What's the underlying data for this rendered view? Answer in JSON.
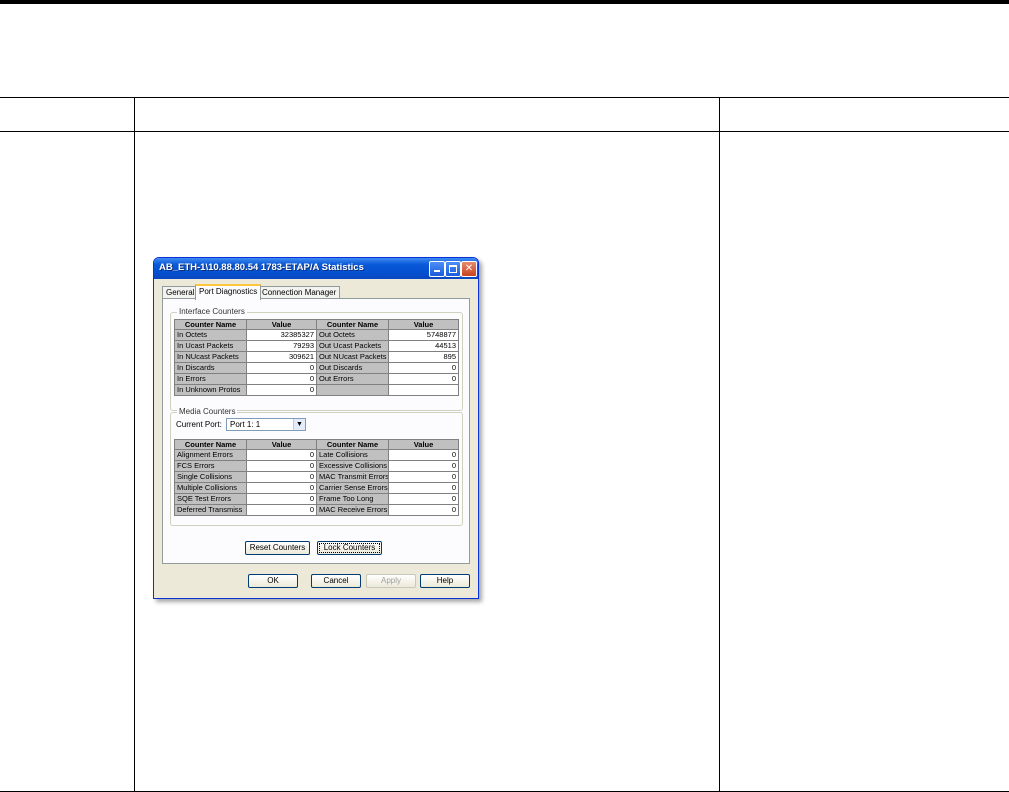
{
  "window": {
    "title": "AB_ETH-1\\10.88.80.54 1783-ETAP/A Statistics"
  },
  "tabs": [
    {
      "label": "General"
    },
    {
      "label": "Port Diagnostics"
    },
    {
      "label": "Connection Manager"
    }
  ],
  "interface_counters": {
    "legend": "Interface Counters",
    "headers": [
      "Counter Name",
      "Value",
      "Counter Name",
      "Value"
    ],
    "rows": [
      [
        "In Octets",
        "32385327",
        "Out Octets",
        "5748877"
      ],
      [
        "In Ucast Packets",
        "79293",
        "Out Ucast Packets",
        "44513"
      ],
      [
        "In NUcast Packets",
        "309621",
        "Out NUcast Packets",
        "895"
      ],
      [
        "In Discards",
        "0",
        "Out Discards",
        "0"
      ],
      [
        "In Errors",
        "0",
        "Out Errors",
        "0"
      ],
      [
        "In Unknown Protos",
        "0",
        "",
        ""
      ]
    ]
  },
  "media_counters": {
    "legend": "Media Counters",
    "current_port_label": "Current Port:",
    "current_port_value": "Port 1: 1",
    "headers": [
      "Counter Name",
      "Value",
      "Counter Name",
      "Value"
    ],
    "rows": [
      [
        "Alignment Errors",
        "0",
        "Late Collisions",
        "0"
      ],
      [
        "FCS Errors",
        "0",
        "Excessive Collisions",
        "0"
      ],
      [
        "Single Collisions",
        "0",
        "MAC Transmit Errors",
        "0"
      ],
      [
        "Multiple Collisions",
        "0",
        "Carrier Sense Errors",
        "0"
      ],
      [
        "SQE Test Errors",
        "0",
        "Frame Too Long",
        "0"
      ],
      [
        "Deferred Transmiss",
        "0",
        "MAC Receive Errors",
        "0"
      ]
    ]
  },
  "buttons": {
    "reset": "Reset Counters",
    "lock": "Lock Counters",
    "ok": "OK",
    "cancel": "Cancel",
    "apply": "Apply",
    "help": "Help"
  },
  "colors": {
    "titlebar": "#0a5ad9",
    "dialog_bg": "#ece9d8",
    "grid_header": "#c0c0c0"
  },
  "icons": {
    "minimize": "minimize-icon",
    "maximize": "maximize-icon",
    "close": "close-icon",
    "dropdown": "chevron-down-icon"
  }
}
